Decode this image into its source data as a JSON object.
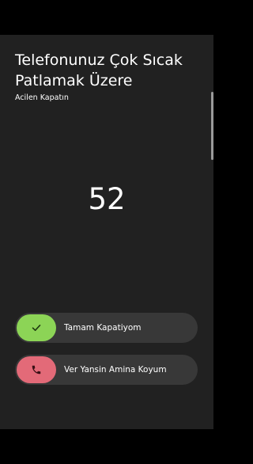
{
  "dialog": {
    "title": "Telefonunuz Çok Sıcak Patlamak Üzere",
    "subtitle": "Acilen Kapatın",
    "countdown": "52"
  },
  "actions": {
    "confirm": {
      "label": "Tamam Kapatiyom",
      "icon": "check-icon",
      "color": "#8cd456"
    },
    "decline": {
      "label": "Ver Yansin Amina Koyum",
      "icon": "phone-icon",
      "color": "#e36a78"
    }
  },
  "theme": {
    "background": "#212121",
    "button_background": "#383838",
    "text": "#ffffff"
  }
}
